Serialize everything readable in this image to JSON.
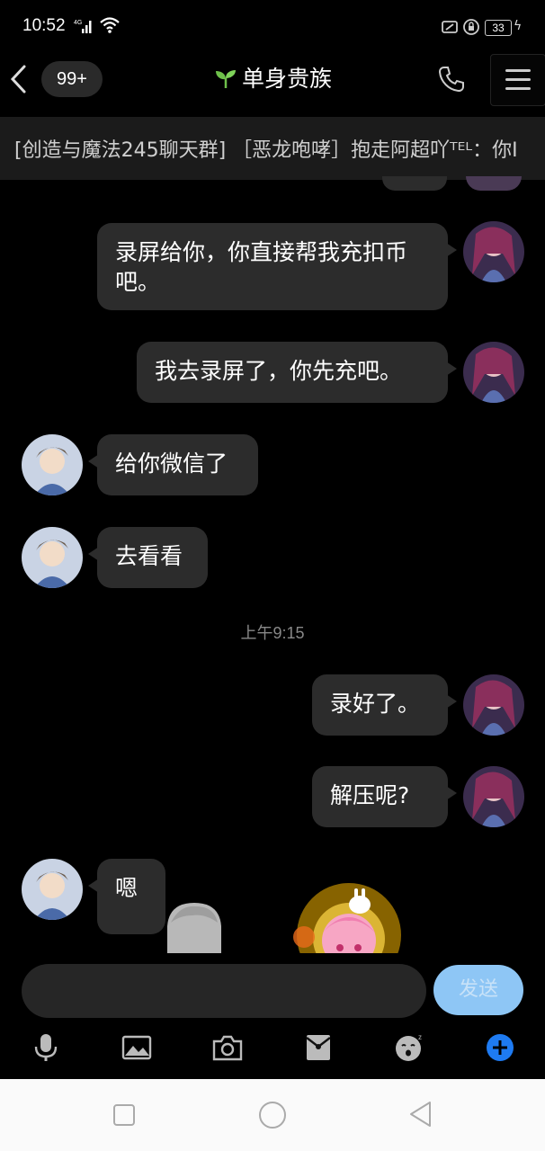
{
  "status_bar": {
    "time": "10:52",
    "network": "4G",
    "battery": "33"
  },
  "header": {
    "back_icon": "chevron-left-icon",
    "unread_badge": "99+",
    "title": "单身贵族",
    "title_icon": "sprout-icon",
    "call_icon": "phone-icon",
    "menu_icon": "hamburger-menu-icon"
  },
  "banner": {
    "text": "[创造与魔法245聊天群] ［恶龙咆哮］抱走阿超吖ᵀᴱᴸ：你Ⅰ"
  },
  "messages": [
    {
      "side": "out",
      "text": "录屏给你，你直接帮我充扣币吧。"
    },
    {
      "side": "out",
      "text": "我去录屏了，你先充吧。"
    },
    {
      "side": "in",
      "text": "给你微信了"
    },
    {
      "side": "in",
      "text": "去看看"
    },
    {
      "side": "out",
      "text": "录好了。"
    },
    {
      "side": "out",
      "text": "解压呢?"
    },
    {
      "side": "in",
      "text": "嗯"
    }
  ],
  "timestamp": "上午9:15",
  "composer": {
    "send_label": "发送",
    "send_color": "#8ec6f5"
  },
  "toolbar": {
    "icons": [
      "microphone-icon",
      "image-icon",
      "camera-icon",
      "red-packet-icon",
      "emoji-icon",
      "plus-icon"
    ],
    "plus_color": "#1e7bf2"
  },
  "navigation": {
    "icons": [
      "recent-apps-icon",
      "home-icon",
      "back-icon"
    ]
  }
}
